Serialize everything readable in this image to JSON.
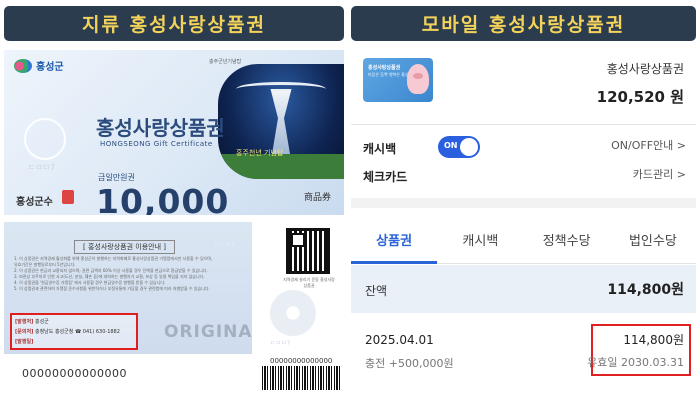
{
  "headers": {
    "left": "지류 홍성사랑상품권",
    "right": "모바일 홍성사랑상품권"
  },
  "paper_front": {
    "logo": "홍성군",
    "serial_note": "충주군년기념탑",
    "title": "홍성사랑상품권",
    "subtitle": "HONGSEONG Gift Certificate",
    "amount_label": "금일만원권",
    "amount": "10,000",
    "issuer": "홍성군수",
    "kind": "商品券",
    "photo_caption": "홍주천년 기념탑",
    "watermark": "ㄷㅁㅁ7"
  },
  "paper_back": {
    "title": "[ 홍성사랑상품권 이용안내 ]",
    "terms": [
      "1. 이 상품권은 지역경제 활성화를 위해 홍성군이 발행하는 지역화폐로 홍성사랑상품권 가맹점에서만 사용할 수 있으며,",
      "   유효기간은 발행일로부터 5년입니다.",
      "2. 이 상품권은 현금과 교환되지 않으며, 권면 금액의 60% 이상 사용할 경우 잔액을 현금으로 환급받을 수 있습니다.",
      "3. 보관상 부주의로 인한 사고(도난, 분실, 훼손 등)에 대하여는 발행자가 교환, 보상 등 일절 책임을 지지 않습니다.",
      "4. 이 상품권을 '현금영수증 가맹점' 에서 사용할 경우 현금영수증 발행을 받을 수 있습니다.",
      "5. 이 상품권과 관련하여 가맹점 준수사항을 위반하거나 부정유통에 가담할 경우 관련법에 따라 처벌받을 수 있습니다."
    ],
    "issue_info": {
      "issuer_label": "[발행처]",
      "issuer": "홍성군",
      "contact_label": "[문의처]",
      "contact": "충청남도 홍성군청 ☎ 041) 630-1882",
      "date_label": "[발행일]",
      "date": ""
    },
    "original": "ORIGINAL",
    "watermark": "ㄷㅁㅁ7",
    "qr_caption": "지역경제 살리기 운동 홍성사랑상품권",
    "serial_small": "00000000000000",
    "serial_main": "00000000000000"
  },
  "mobile": {
    "card_title": "홍성사랑상품권",
    "card_sub": "마음은 듬뿍 행복은 홍성",
    "card_name": "홍성사랑상품권",
    "card_amount": "120,520 원",
    "cashback_label": "캐시백",
    "toggle_text": "ON",
    "onoff_link": "ON/OFF안내 >",
    "checkcard_label": "체크카드",
    "cardmgmt_link": "카드관리 >",
    "tabs": [
      "상품권",
      "캐시백",
      "정책수당",
      "법인수당"
    ],
    "balance_label": "잔액",
    "balance_value": "114,800원",
    "history": {
      "date": "2025.04.01",
      "charge": "충전 +500,000원",
      "value": "114,800원",
      "expiry": "유효일 2030.03.31"
    }
  }
}
